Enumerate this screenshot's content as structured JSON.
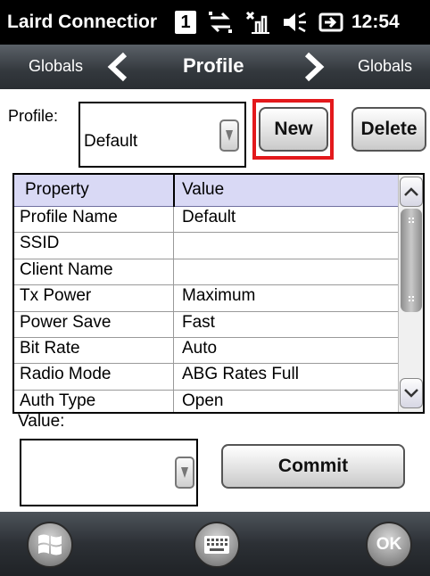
{
  "status_bar": {
    "app_title": "Laird Connectior",
    "notification_count": "1",
    "time": "12:54",
    "icons": [
      "notification-icon",
      "connectivity-icon",
      "signal-off-icon",
      "volume-icon",
      "battery-charging-icon"
    ]
  },
  "nav": {
    "prev_label": "Globals",
    "title": "Profile",
    "next_label": "Globals"
  },
  "profile_section": {
    "label": "Profile:",
    "selected_value": "Default",
    "new_button": "New",
    "delete_button": "Delete",
    "highlight_color": "#e3191c"
  },
  "grid": {
    "headers": {
      "property": "Property",
      "value": "Value"
    },
    "rows": [
      {
        "property": "Profile Name",
        "value": "Default"
      },
      {
        "property": "SSID",
        "value": ""
      },
      {
        "property": "Client Name",
        "value": ""
      },
      {
        "property": "Tx Power",
        "value": "Maximum"
      },
      {
        "property": "Power Save",
        "value": "Fast"
      },
      {
        "property": "Bit Rate",
        "value": "Auto"
      },
      {
        "property": "Radio Mode",
        "value": "ABG Rates Full"
      },
      {
        "property": "Auth Type",
        "value": "Open"
      }
    ]
  },
  "value_section": {
    "label": "Value:",
    "selected_value": "",
    "commit_button": "Commit"
  },
  "softkeys": {
    "left_icon": "windows-start-icon",
    "center_icon": "keyboard-icon",
    "right_label": "OK"
  }
}
